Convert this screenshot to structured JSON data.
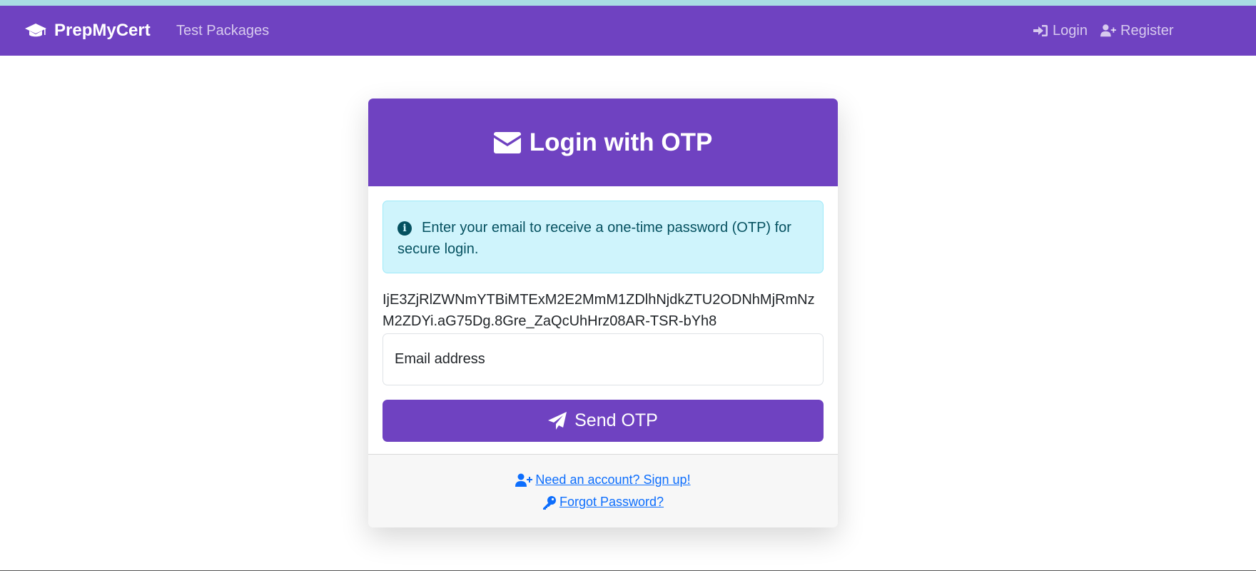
{
  "navbar": {
    "brand": "PrepMyCert",
    "brand_icon": "graduation-cap-icon",
    "links": {
      "packages": "Test Packages",
      "login": "Login",
      "register": "Register"
    }
  },
  "card": {
    "title": "Login with OTP",
    "title_icon": "envelope-icon",
    "alert": "Enter your email to receive a one-time password (OTP) for secure login.",
    "token": "IjE3ZjRlZWNmYTBiMTExM2E2MmM1ZDlhNjdkZTU2ODNhMjRmNzM2ZDYi.aG75Dg.8Gre_ZaQcUhHrz08AR-TSR-bYh8",
    "email_placeholder": "Email address",
    "email_value": "",
    "submit_label": "Send OTP",
    "footer": {
      "signup": "Need an account? Sign up!",
      "forgot": "Forgot Password?"
    }
  },
  "colors": {
    "primary": "#6f42c1",
    "alert_bg": "#cff4fc",
    "alert_text": "#055160",
    "link": "#0d6efd"
  }
}
